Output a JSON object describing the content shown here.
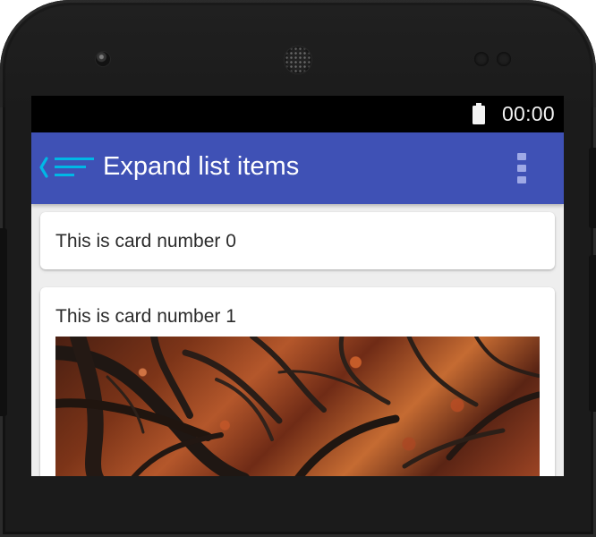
{
  "status_bar": {
    "time": "00:00",
    "battery_icon": "battery-full-icon"
  },
  "toolbar": {
    "title": "Expand list items",
    "nav_icon": "menu-icon",
    "back_icon": "back-chevron-icon",
    "overflow_icon": "more-vert-icon",
    "color": "#3f51b5",
    "accent": "#00b7e6"
  },
  "cards": [
    {
      "title": "This is card number 0"
    },
    {
      "title": "This is card number 1",
      "image": "autumn-tree-photo"
    }
  ]
}
